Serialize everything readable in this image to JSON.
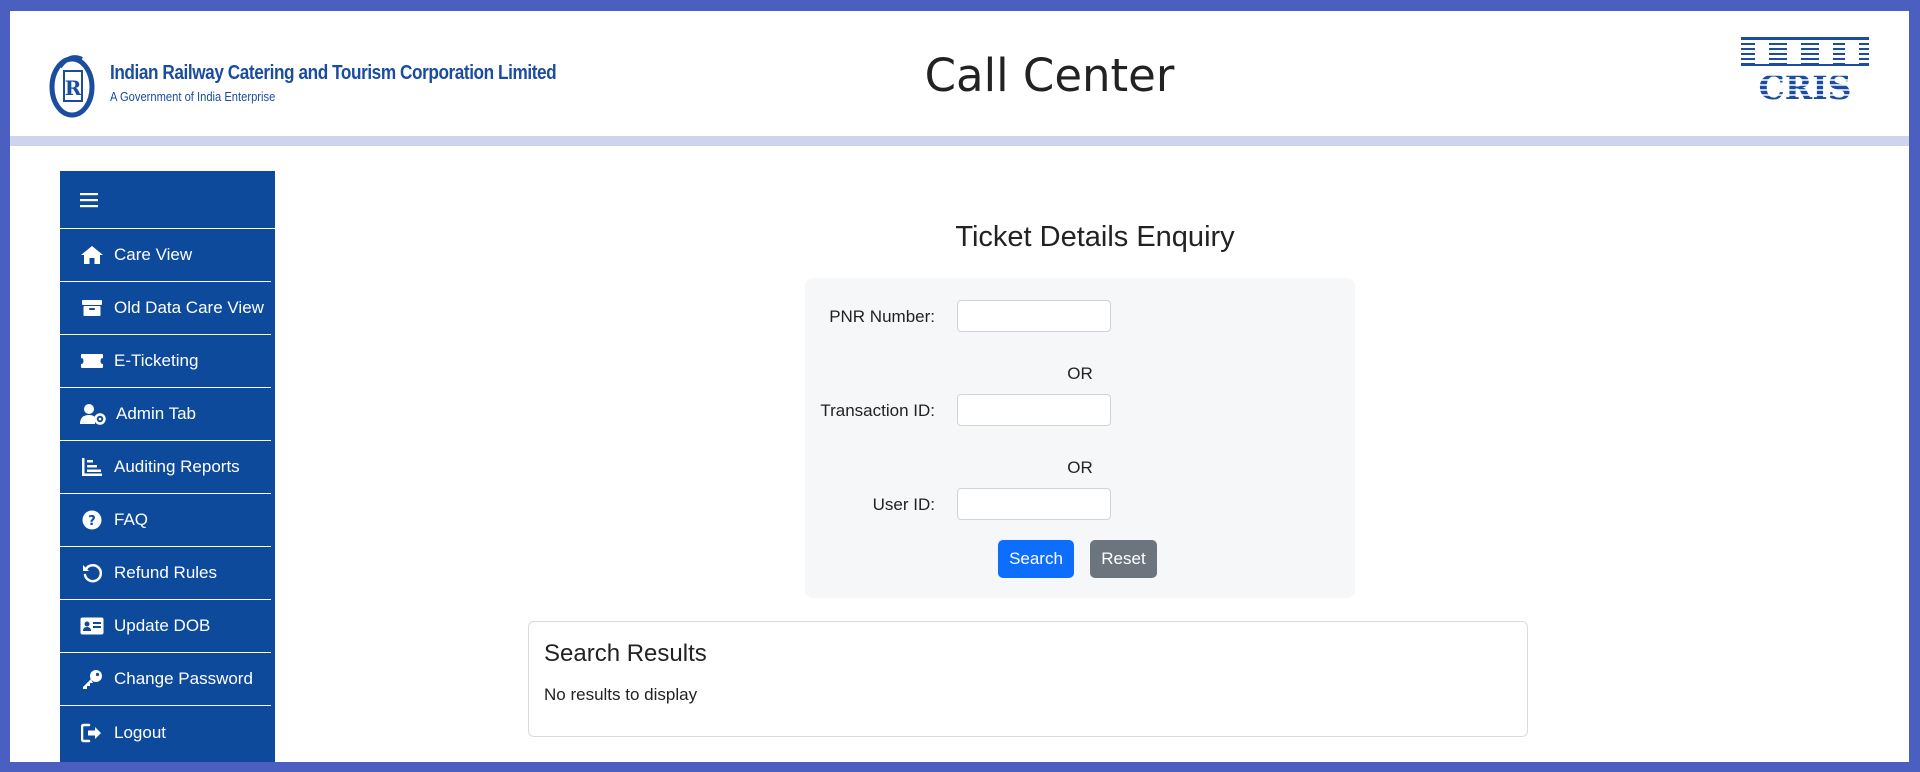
{
  "header": {
    "org_name": "Indian Railway Catering and Tourism Corporation Limited",
    "org_subtitle": "A Government of India Enterprise",
    "app_title": "Call Center",
    "right_logo_text": "CRIS"
  },
  "sidebar": {
    "toggle_icon": "hamburger-icon",
    "items": [
      {
        "label": "Care View",
        "icon": "home-icon"
      },
      {
        "label": "Old Data Care View",
        "icon": "archive-icon"
      },
      {
        "label": "E-Ticketing",
        "icon": "ticket-icon"
      },
      {
        "label": "Admin Tab",
        "icon": "user-cog-icon"
      },
      {
        "label": "Auditing Reports",
        "icon": "bar-chart-icon"
      },
      {
        "label": "FAQ",
        "icon": "question-circle-icon"
      },
      {
        "label": "Refund Rules",
        "icon": "undo-icon"
      },
      {
        "label": "Update DOB",
        "icon": "id-card-icon"
      },
      {
        "label": "Change Password",
        "icon": "key-icon"
      },
      {
        "label": "Logout",
        "icon": "sign-out-icon"
      }
    ]
  },
  "enquiry": {
    "title": "Ticket Details Enquiry",
    "pnr_label": "PNR Number:",
    "pnr_value": "",
    "or_1": "OR",
    "txn_label": "Transaction ID:",
    "txn_value": "",
    "or_2": "OR",
    "user_label": "User ID:",
    "user_value": "",
    "search_label": "Search",
    "reset_label": "Reset"
  },
  "results": {
    "title": "Search Results",
    "empty_text": "No results to display"
  },
  "colors": {
    "frame_border": "#4a5fbf",
    "sidebar_bg": "#0d4a9c",
    "primary_button": "#0d6efd",
    "secondary_button": "#6c757d",
    "brand_blue": "#1a4da0"
  }
}
